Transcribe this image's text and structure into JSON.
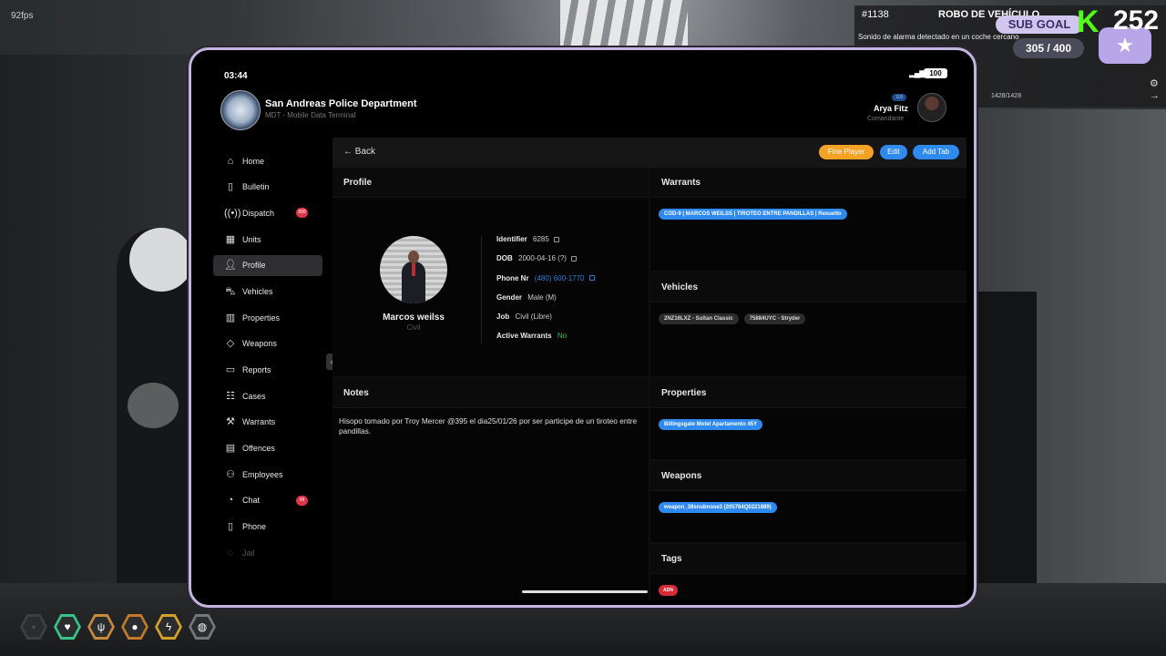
{
  "overlay": {
    "fps": "92fps",
    "call_id": "#1138",
    "call_title": "ROBO DE VEHÍCULO",
    "call_message": "Sonido de alarma detectado en un coche cercano",
    "call_small": "1428/1428",
    "sub_goal": "SUB GOAL",
    "goal_count": "305 / 400",
    "viewer_count": "252",
    "kick_logo": "K"
  },
  "tablet": {
    "time": "03:44",
    "battery": "100",
    "department": "San Andreas Police Department",
    "subtitle": "MDT - Mobile Data Terminal",
    "user_badge": "118",
    "user_name": "Arya Fitz",
    "user_role": "Comandante"
  },
  "sidebar": {
    "items": [
      {
        "label": "Home",
        "icon": "home-icon"
      },
      {
        "label": "Bulletin",
        "icon": "bookmark-icon"
      },
      {
        "label": "Dispatch",
        "icon": "broadcast-icon",
        "badge": "999"
      },
      {
        "label": "Units",
        "icon": "grid-icon"
      },
      {
        "label": "Profile",
        "icon": "person-icon"
      },
      {
        "label": "Vehicles",
        "icon": "car-icon"
      },
      {
        "label": "Properties",
        "icon": "building-icon"
      },
      {
        "label": "Weapons",
        "icon": "crosshair-icon"
      },
      {
        "label": "Reports",
        "icon": "folder-icon"
      },
      {
        "label": "Cases",
        "icon": "clipboard-icon"
      },
      {
        "label": "Warrants",
        "icon": "gavel-icon"
      },
      {
        "label": "Offences",
        "icon": "book-icon"
      },
      {
        "label": "Employees",
        "icon": "users-icon"
      },
      {
        "label": "Chat",
        "icon": "chat-icon",
        "badge": "99"
      },
      {
        "label": "Phone",
        "icon": "phone-icon"
      },
      {
        "label": "Jail",
        "icon": "lock-icon"
      }
    ]
  },
  "toolbar": {
    "back_label": "Back",
    "fine_label": "Fine Player",
    "edit_label": "Edit",
    "add_tab_label": "Add Tab"
  },
  "profile": {
    "section_title": "Profile",
    "name": "Marcos weilss",
    "class": "Civil",
    "fields": {
      "identifier_label": "Identifier",
      "identifier_value": "6285",
      "dob_label": "DOB",
      "dob_value": "2000-04-16 (?)",
      "phone_label": "Phone Nr",
      "phone_value": "(480) 600-1770",
      "gender_label": "Gender",
      "gender_value": "Male (M)",
      "job_label": "Job",
      "job_value": "Civil (Libre)",
      "warrants_label": "Active Warrants",
      "warrants_value": "No"
    }
  },
  "notes": {
    "section_title": "Notes",
    "text": "Hisopo tomado por Troy Mercer @395 el dia25/01/26 por ser participe de un tiroteo entre pandillas."
  },
  "warrants": {
    "section_title": "Warrants",
    "items": [
      "COD-9 | MARCOS WEILSS | TIROTEO ENTRE PANDILLAS | Resuelto"
    ]
  },
  "vehicles": {
    "section_title": "Vehicles",
    "items": [
      "2NZ16LXZ - Sultan Classic",
      "75884UYC - Stryder"
    ]
  },
  "properties": {
    "section_title": "Properties",
    "items": [
      "Billingsgate Motel Apartamento 45Y"
    ]
  },
  "weapons": {
    "section_title": "Weapons",
    "items": [
      "weapon_38snubnose3 (205784Q0221889)"
    ]
  },
  "tags": {
    "section_title": "Tags",
    "items": [
      "ADN"
    ]
  },
  "colors": {
    "accent_blue": "#2f8af0",
    "accent_orange": "#f4a226",
    "tag_red": "#d72b3a",
    "frame_lavender": "#c4b5de"
  }
}
